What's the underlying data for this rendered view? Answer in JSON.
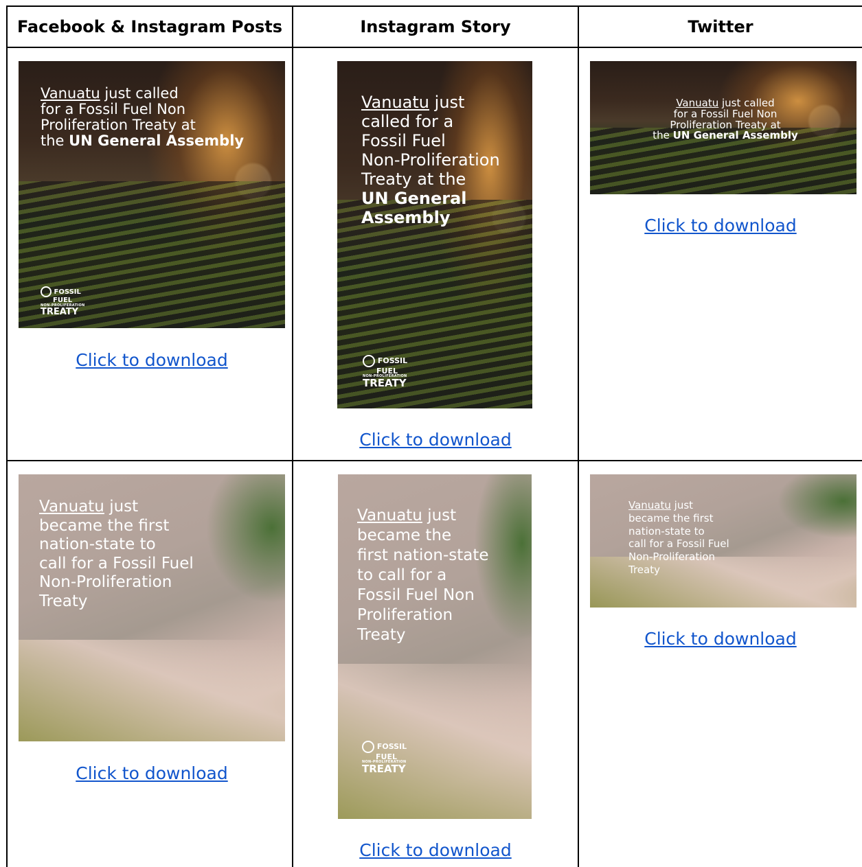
{
  "headers": {
    "col1": "Facebook & Instagram Posts",
    "col2": "Instagram Story",
    "col3": "Twitter"
  },
  "row1": {
    "post": {
      "line1_link": "Vanuatu",
      "line1_rest": " just called",
      "line2": "for a Fossil Fuel Non",
      "line3": "Proliferation Treaty at",
      "line4_pre": "the ",
      "line4_bold": "UN General Assembly"
    },
    "story": {
      "line1_link": "Vanuatu",
      "line1_rest": " just",
      "line2": "called for a",
      "line3": "Fossil Fuel",
      "line4": "Non-Proliferation",
      "line5": "Treaty at the",
      "line6_bold": "UN General",
      "line7_bold": "Assembly"
    },
    "twitter": {
      "line1_link": "Vanuatu",
      "line1_rest": " just called",
      "line2": "for a Fossil Fuel Non",
      "line3": "Proliferation Treaty at",
      "line4_pre": "the ",
      "line4_bold": "UN General Assembly"
    }
  },
  "row2": {
    "post": {
      "line1_link": "Vanuatu",
      "line1_rest": " just",
      "line2": "became the first",
      "line3": "nation-state to",
      "line4": "call for a Fossil Fuel",
      "line5": "Non-Proliferation",
      "line6": "Treaty"
    },
    "story": {
      "line1_link": "Vanuatu",
      "line1_rest": " just",
      "line2": "became the",
      "line3": "first nation-state",
      "line4": "to call for a",
      "line5": "Fossil Fuel Non",
      "line6": "Proliferation",
      "line7": "Treaty"
    },
    "twitter": {
      "line1_link": "Vanuatu",
      "line1_rest": " just",
      "line2": "became the first",
      "line3": "nation-state to",
      "line4": "call for a Fossil Fuel",
      "line5": "Non-Proliferation",
      "line6": "Treaty"
    }
  },
  "logo": {
    "fossil": "FOSSIL",
    "fuel": "FUEL",
    "np": "NON-PROLIFERATION",
    "treaty": "TREATY"
  },
  "download_label": "Click to download",
  "colors": {
    "link": "#1155cc",
    "border": "#000000"
  }
}
